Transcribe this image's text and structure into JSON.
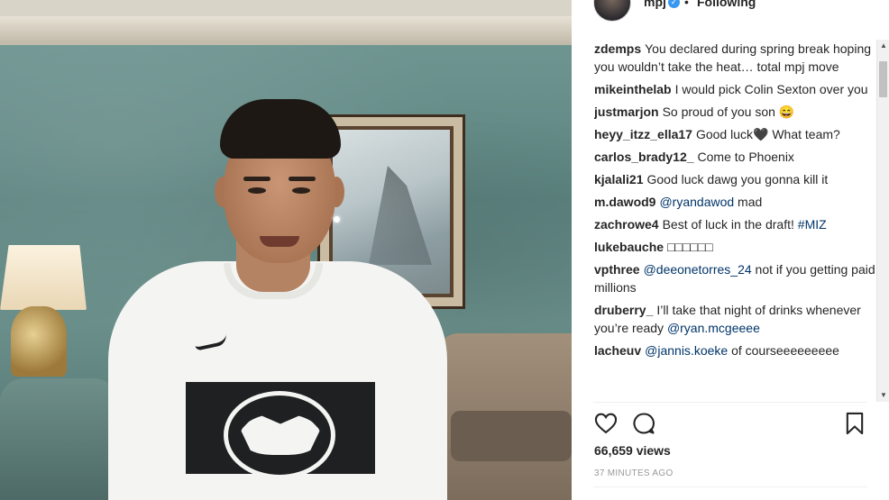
{
  "header": {
    "username": "mpj",
    "verified_mark": "✓",
    "separator": "•",
    "follow_status": "Following"
  },
  "comments": [
    {
      "user": "zdemps",
      "parts": [
        {
          "t": "You declared during spring break hoping you wouldn’t take the heat… total mpj move",
          "mention": false
        }
      ]
    },
    {
      "user": "mikeinthelab",
      "parts": [
        {
          "t": "I would pick Colin Sexton over you",
          "mention": false
        }
      ]
    },
    {
      "user": "justmarjon",
      "parts": [
        {
          "t": "So proud of you son 😄",
          "mention": false
        }
      ]
    },
    {
      "user": "heyy_itzz_ella17",
      "parts": [
        {
          "t": "Good luck🖤 What team?",
          "mention": false
        }
      ]
    },
    {
      "user": "carlos_brady12_",
      "parts": [
        {
          "t": "Come to Phoenix",
          "mention": false
        }
      ]
    },
    {
      "user": "kjalali21",
      "parts": [
        {
          "t": "Good luck dawg you gonna kill it",
          "mention": false
        }
      ]
    },
    {
      "user": "m.dawod9",
      "parts": [
        {
          "t": "@ryandawod",
          "mention": true
        },
        {
          "t": " mad",
          "mention": false
        }
      ]
    },
    {
      "user": "zachrowe4",
      "parts": [
        {
          "t": "Best of luck in the draft! ",
          "mention": false
        },
        {
          "t": "#MIZ",
          "mention": true
        }
      ]
    },
    {
      "user": "lukebauche",
      "parts": [
        {
          "t": "□□□□□□",
          "mention": false
        }
      ]
    },
    {
      "user": "vpthree",
      "parts": [
        {
          "t": "@deeonetorres_24",
          "mention": true
        },
        {
          "t": " not if you getting paid millions",
          "mention": false
        }
      ]
    },
    {
      "user": "druberry_",
      "parts": [
        {
          "t": "I’ll take that night of drinks whenever you’re ready ",
          "mention": false
        },
        {
          "t": "@ryan.mcgeeee",
          "mention": true
        }
      ]
    },
    {
      "user": "lacheuv",
      "parts": [
        {
          "t": "@jannis.koeke",
          "mention": true
        },
        {
          "t": " of courseeeeeeeee",
          "mention": false
        }
      ]
    }
  ],
  "scrollbar": {
    "up": "▲",
    "down": "▼"
  },
  "actions": {
    "like_icon": "heart-icon",
    "comment_icon": "comment-bubble-icon",
    "save_icon": "bookmark-icon"
  },
  "stats": {
    "views": "66,659 views",
    "posted": "37 MINUTES AGO"
  },
  "colors": {
    "text": "#262626",
    "mention": "#003569",
    "verified": "#3897f0",
    "muted": "#999999"
  }
}
